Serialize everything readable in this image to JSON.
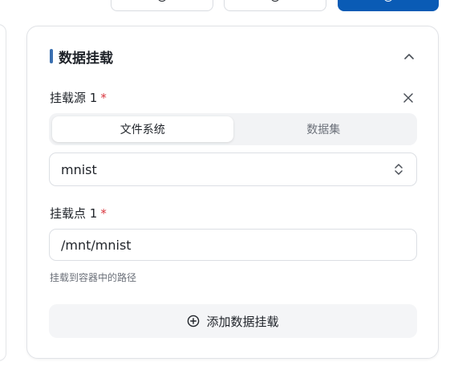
{
  "top_actions": {
    "secondary_1_label": "…",
    "secondary_2_label": "…",
    "primary_label": "…"
  },
  "section": {
    "title": "数据挂载",
    "collapsed": false
  },
  "mount_source": {
    "label": "挂载源 1",
    "required_mark": "*",
    "tabs": [
      "文件系统",
      "数据集"
    ],
    "active_tab": "文件系统",
    "selected_value": "mnist"
  },
  "mount_point": {
    "label": "挂载点 1",
    "required_mark": "*",
    "value": "/mnt/mnist",
    "hint": "挂载到容器中的路径"
  },
  "add_mount": {
    "label": "添加数据挂载"
  },
  "colors": {
    "primary": "#0a5bb5",
    "accent_bar": "#3a6fb0",
    "required": "#d9363e"
  }
}
